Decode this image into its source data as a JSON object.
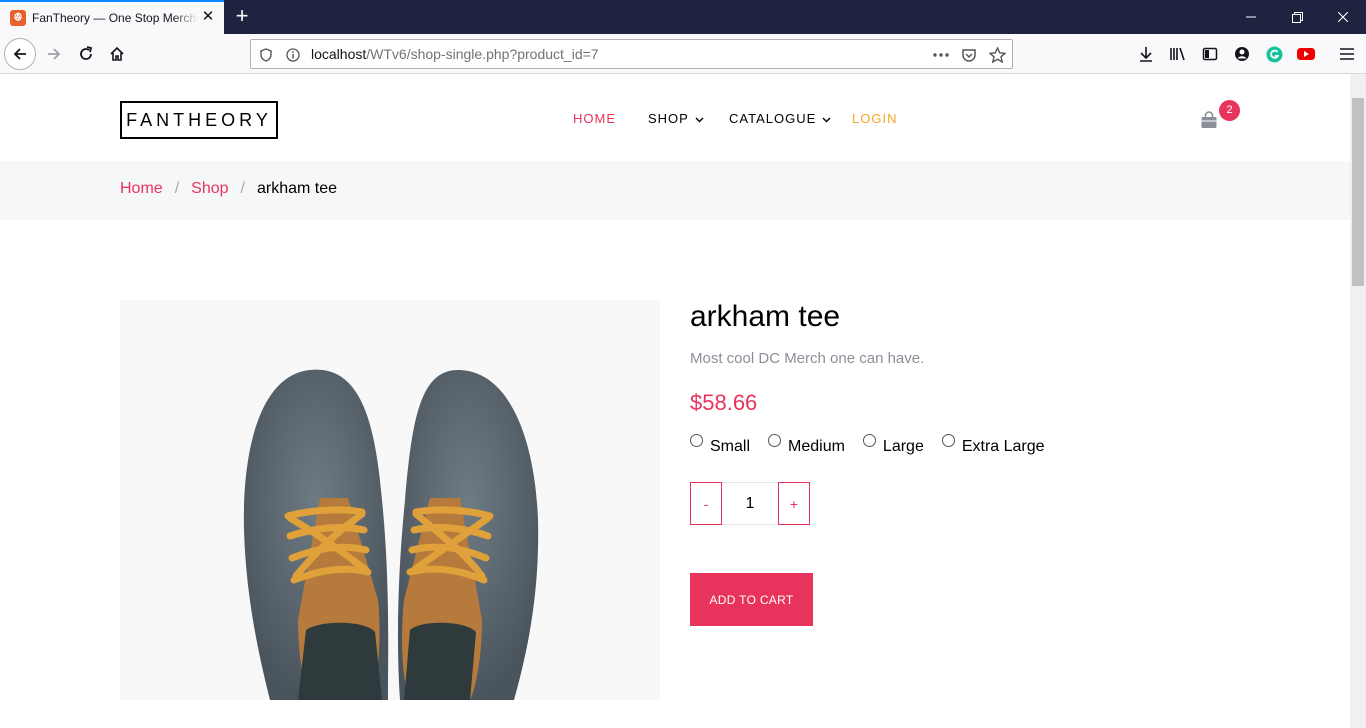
{
  "browser": {
    "tab_title": "FanTheory — One Stop Merche",
    "favicon_glyph": "ꔮ",
    "new_tab_glyph": "+",
    "url_host": "localhost",
    "url_path": "/WTv6/shop-single.php?product_id=7"
  },
  "site": {
    "logo": "FANTHEORY",
    "menu": {
      "home": "HOME",
      "shop": "SHOP",
      "catalogue": "CATALOGUE",
      "login": "LOGIN"
    },
    "cart_count": "2",
    "accent_color": "#e8345c",
    "login_color": "#f5a623"
  },
  "breadcrumb": {
    "home": "Home",
    "shop": "Shop",
    "separator": "/",
    "current": "arkham tee"
  },
  "product": {
    "title": "arkham tee",
    "description": "Most cool DC Merch one can have.",
    "price": "$58.66",
    "sizes": [
      "Small",
      "Medium",
      "Large",
      "Extra Large"
    ],
    "quantity": "1",
    "minus": "-",
    "plus": "+",
    "add_to_cart": "ADD TO CART",
    "image_subject": "grey felt shoes with orange laces (top view)"
  }
}
